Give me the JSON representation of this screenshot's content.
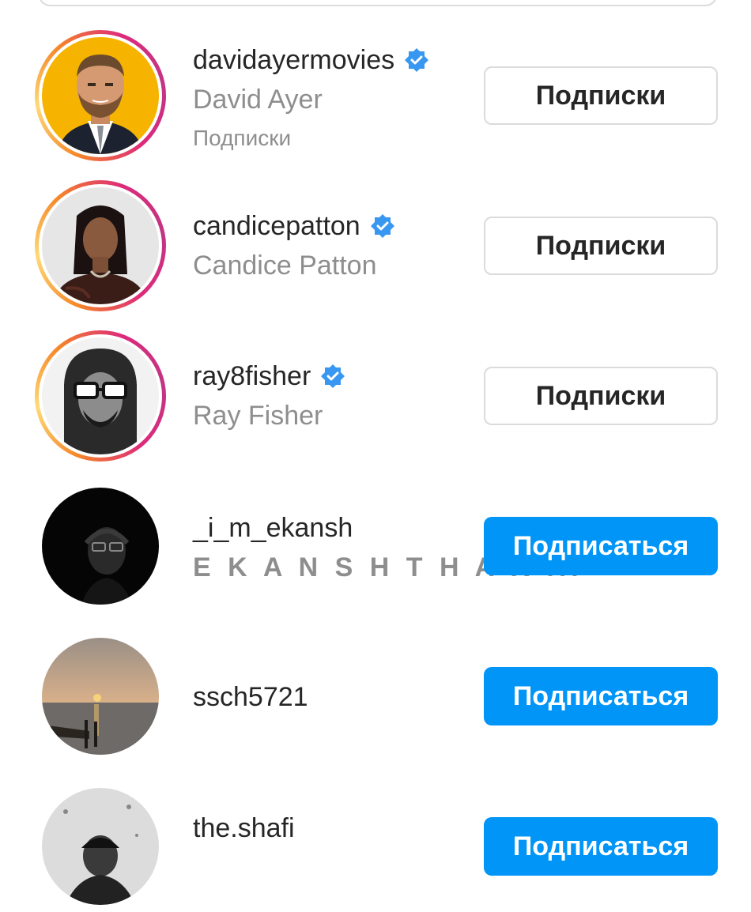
{
  "colors": {
    "primary_text": "#262626",
    "secondary_text": "#8e8e8e",
    "follow_blue": "#0095f6",
    "verified_blue": "#3897f0",
    "border": "#dbdbdb"
  },
  "users": [
    {
      "username": "davidayermovies",
      "full_name": "David Ayer",
      "note": "Подписки",
      "verified": true,
      "story_ring": true,
      "button_label": "Подписки",
      "button_state": "following",
      "avatar_icon": "avatar-illustrated-man-yellow-bg"
    },
    {
      "username": "candicepatton",
      "full_name": "Candice Patton",
      "note": "",
      "verified": true,
      "story_ring": true,
      "button_label": "Подписки",
      "button_state": "following",
      "avatar_icon": "avatar-woman-photo"
    },
    {
      "username": "ray8fisher",
      "full_name": "Ray Fisher",
      "note": "",
      "verified": true,
      "story_ring": true,
      "button_label": "Подписки",
      "button_state": "following",
      "avatar_icon": "avatar-man-hood-glasses-bw"
    },
    {
      "username": "_i_m_ekansh",
      "full_name": "E K A N S H  T H A K ...",
      "note": "",
      "verified": false,
      "story_ring": false,
      "button_label": "Подписаться",
      "button_state": "follow",
      "avatar_icon": "avatar-dark-portrait"
    },
    {
      "username": "ssch5721",
      "full_name": "",
      "note": "",
      "verified": false,
      "story_ring": false,
      "button_label": "Подписаться",
      "button_state": "follow",
      "avatar_icon": "avatar-sunset-pier"
    },
    {
      "username": "the.shafi",
      "full_name": "",
      "note": "",
      "verified": false,
      "story_ring": false,
      "button_label": "Подписаться",
      "button_state": "follow",
      "avatar_icon": "avatar-man-grey-bg"
    }
  ]
}
